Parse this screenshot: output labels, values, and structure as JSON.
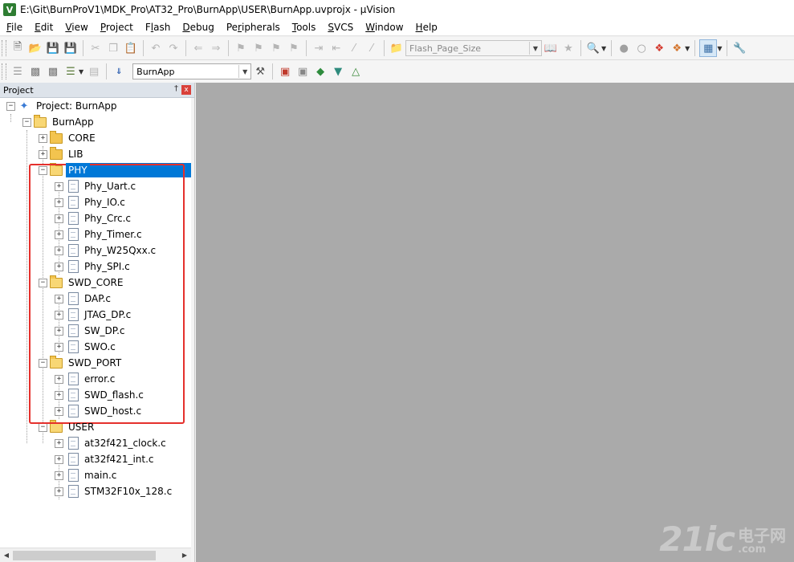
{
  "window": {
    "title": "E:\\Git\\BurnProV1\\MDK_Pro\\AT32_Pro\\BurnApp\\USER\\BurnApp.uvprojx - µVision",
    "icon": "V"
  },
  "menu": [
    {
      "label": "File",
      "u": "F",
      "rest": "ile"
    },
    {
      "label": "Edit",
      "u": "E",
      "rest": "dit"
    },
    {
      "label": "View",
      "u": "V",
      "rest": "iew"
    },
    {
      "label": "Project",
      "u": "P",
      "rest": "roject"
    },
    {
      "label": "Flash",
      "pre": "F",
      "u": "l",
      "rest": "ash"
    },
    {
      "label": "Debug",
      "u": "D",
      "rest": "ebug"
    },
    {
      "label": "Peripherals",
      "pre": "Pe",
      "u": "r",
      "rest": "ipherals"
    },
    {
      "label": "Tools",
      "u": "T",
      "rest": "ools"
    },
    {
      "label": "SVCS",
      "u": "S",
      "rest": "VCS"
    },
    {
      "label": "Window",
      "u": "W",
      "rest": "indow"
    },
    {
      "label": "Help",
      "u": "H",
      "rest": "elp"
    }
  ],
  "toolbar": {
    "find_combo": "Flash_Page_Size",
    "target_combo": "BurnApp"
  },
  "panel": {
    "title": "Project",
    "pin": "†",
    "close": "x"
  },
  "tree": {
    "project": "Project: BurnApp",
    "target": "BurnApp",
    "groups": {
      "core": "CORE",
      "lib": "LIB",
      "phy": "PHY",
      "swd_core": "SWD_CORE",
      "swd_port": "SWD_PORT",
      "user": "USER"
    },
    "phy_files": [
      "Phy_Uart.c",
      "Phy_IO.c",
      "Phy_Crc.c",
      "Phy_Timer.c",
      "Phy_W25Qxx.c",
      "Phy_SPI.c"
    ],
    "swd_core_files": [
      "DAP.c",
      "JTAG_DP.c",
      "SW_DP.c",
      "SWO.c"
    ],
    "swd_port_files": [
      "error.c",
      "SWD_flash.c",
      "SWD_host.c"
    ],
    "user_files": [
      "at32f421_clock.c",
      "at32f421_int.c",
      "main.c",
      "STM32F10x_128.c"
    ]
  },
  "watermark": {
    "main": "21ic",
    "cn": "电子网",
    "com": ".com"
  }
}
